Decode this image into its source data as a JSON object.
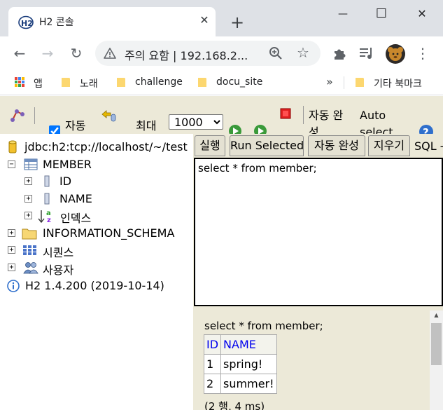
{
  "browser": {
    "tab_title": "H2 콘솔",
    "tab_close": "✕",
    "new_tab": "+",
    "window_controls": {
      "minimize": "—",
      "maximize": "☐",
      "close": "✕"
    },
    "address": "주의 요함  |  192.168.2...",
    "bookmarks": [
      {
        "label": "앱",
        "icon": "apps-grid-icon"
      },
      {
        "label": "노래",
        "icon": "folder-icon"
      },
      {
        "label": "challenge",
        "icon": "folder-icon"
      },
      {
        "label": "docu_site",
        "icon": "folder-icon"
      },
      {
        "label": "»",
        "icon": ""
      },
      {
        "label": "기타 북마크",
        "icon": "folder-icon"
      }
    ]
  },
  "h2_toolbar": {
    "auto_commit_label": "자동",
    "auto_commit_checked": true,
    "max_rows_label": "최대",
    "max_rows_value": "1000",
    "autocomplete_label": "자동 완성",
    "auto_select_label": "Auto select"
  },
  "tree": {
    "connection": "jdbc:h2:tcp://localhost/~/test",
    "items": [
      {
        "label": "MEMBER",
        "toggle": "−"
      },
      {
        "label": "ID",
        "toggle": "+"
      },
      {
        "label": "NAME",
        "toggle": "+"
      },
      {
        "label": "인덱스",
        "toggle": "+"
      },
      {
        "label": "INFORMATION_SCHEMA",
        "toggle": "+"
      },
      {
        "label": "시퀀스",
        "toggle": "+"
      },
      {
        "label": "사용자",
        "toggle": "+"
      }
    ],
    "version": "H2 1.4.200 (2019-10-14)"
  },
  "editor": {
    "buttons": {
      "run": "실행",
      "run_selected": "Run Selected",
      "autocomplete": "자동 완성",
      "clear": "지우기",
      "sql_label": "SQL -"
    },
    "sql": "select * from member;"
  },
  "results": {
    "sql": "select * from member;",
    "columns": [
      "ID",
      "NAME"
    ],
    "rows": [
      [
        "1",
        "spring!"
      ],
      [
        "2",
        "summer!"
      ]
    ],
    "footer": "(2 행, 4 ms)"
  },
  "colors": {
    "panel_bg": "#ece9d8",
    "link_header": "#0000ee",
    "tab_bar": "#dee1e6"
  }
}
